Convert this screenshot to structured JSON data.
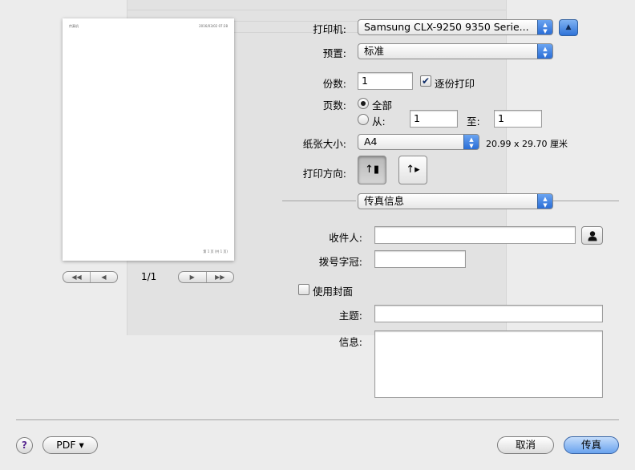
{
  "preview": {
    "header_left": "传真机",
    "header_right": "2016/03/02 07:28",
    "footer": "第 1 页 (共 1 页)",
    "page_indicator": "1/1",
    "nav_first": "◀◀",
    "nav_prev": "◀",
    "nav_next": "▶",
    "nav_last": "▶▶"
  },
  "printer": {
    "label": "打印机:",
    "value": "Samsung CLX-9250 9350 Serie..."
  },
  "presets": {
    "label": "预置:",
    "value": "标准"
  },
  "copies": {
    "label": "份数:",
    "value": "1",
    "collate_label": "逐份打印",
    "collate_checked": true
  },
  "pages": {
    "label": "页数:",
    "all_label": "全部",
    "from_label": "从:",
    "from_value": "1",
    "to_label": "至:",
    "to_value": "1",
    "selected": "all"
  },
  "paper_size": {
    "label": "纸张大小:",
    "value": "A4",
    "dimensions": "20.99 x 29.70 厘米"
  },
  "orientation": {
    "label": "打印方向:",
    "selected": "portrait"
  },
  "section_menu": {
    "value": "传真信息"
  },
  "fax": {
    "recipient_label": "收件人:",
    "recipient_value": "",
    "dial_prefix_label": "拨号字冠:",
    "dial_prefix_value": "",
    "cover_label": "使用封面",
    "cover_checked": false,
    "subject_label": "主题:",
    "subject_value": "",
    "message_label": "信息:",
    "message_value": ""
  },
  "footer": {
    "help": "?",
    "pdf_label": "PDF ▾",
    "cancel_label": "取消",
    "fax_label": "传真"
  },
  "colors": {
    "accent": "#2a6dd6",
    "default_button": "#6aa3ee"
  }
}
